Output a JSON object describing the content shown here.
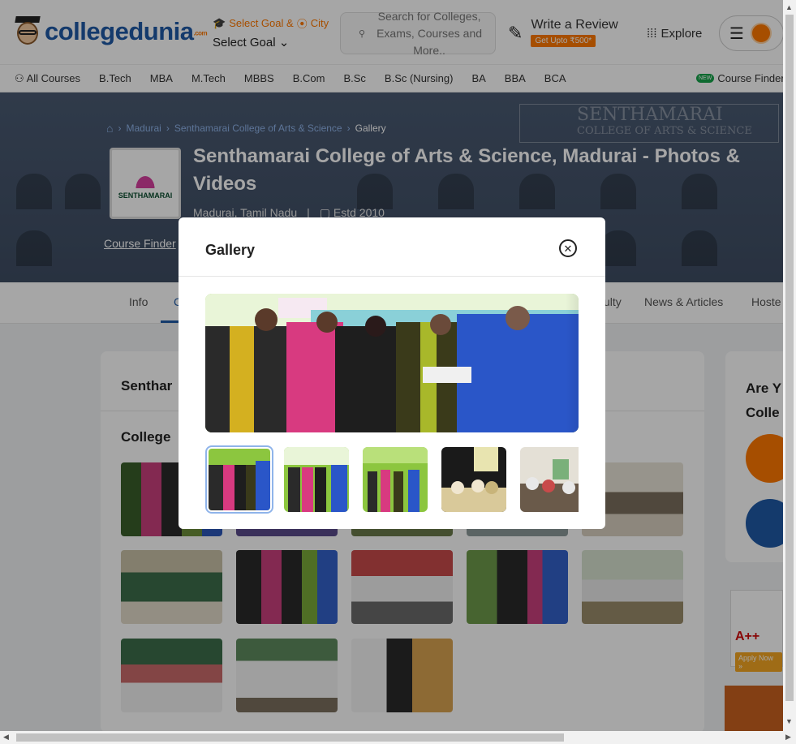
{
  "header": {
    "logo_text": "collegedunia",
    "logo_suffix": ".com",
    "goal_top": "Select Goal & ",
    "goal_city": "City",
    "goal_select": "Select Goal",
    "search_placeholder": "Search for Colleges, Exams, Courses and More..",
    "write_review": "Write a Review",
    "review_badge": "Get Upto ₹500*",
    "explore": "Explore"
  },
  "course_nav": {
    "all_courses": "All Courses",
    "items": [
      "B.Tech",
      "MBA",
      "M.Tech",
      "MBBS",
      "B.Com",
      "B.Sc",
      "B.Sc (Nursing)",
      "BA",
      "BBA",
      "BCA"
    ],
    "finder_badge": "NEW",
    "finder": "Course Finder"
  },
  "banner": {
    "breadcrumb": [
      "Madurai",
      "Senthamarai College of Arts & Science",
      "Gallery"
    ],
    "logo_name": "SENTHAMARAI",
    "title": "Senthamarai College of Arts & Science, Madurai - Photos & Videos",
    "location": "Madurai, Tamil Nadu",
    "estd": "Estd 2010",
    "course_finder_link": "Course Finder",
    "sign_line1": "SENTHAMARAI",
    "sign_line2": "COLLEGE OF ARTS & SCIENCE"
  },
  "tabs": {
    "info": "Info",
    "partial": "C",
    "faculty": "ulty",
    "news": "News & Articles",
    "hostel": "Hoste"
  },
  "content": {
    "heading": "Senthar",
    "subheading": "College",
    "side_question_1": "Are Y",
    "side_question_2": "Colle",
    "ad_naac": "A++",
    "ad_apply": "Apply Now »"
  },
  "modal": {
    "title": "Gallery",
    "close_symbol": "✕",
    "next_symbol": "›"
  },
  "colors": {
    "brand_blue": "#1f5aa6",
    "brand_orange": "#ff7900",
    "banner_bg": "#4a5a72"
  }
}
